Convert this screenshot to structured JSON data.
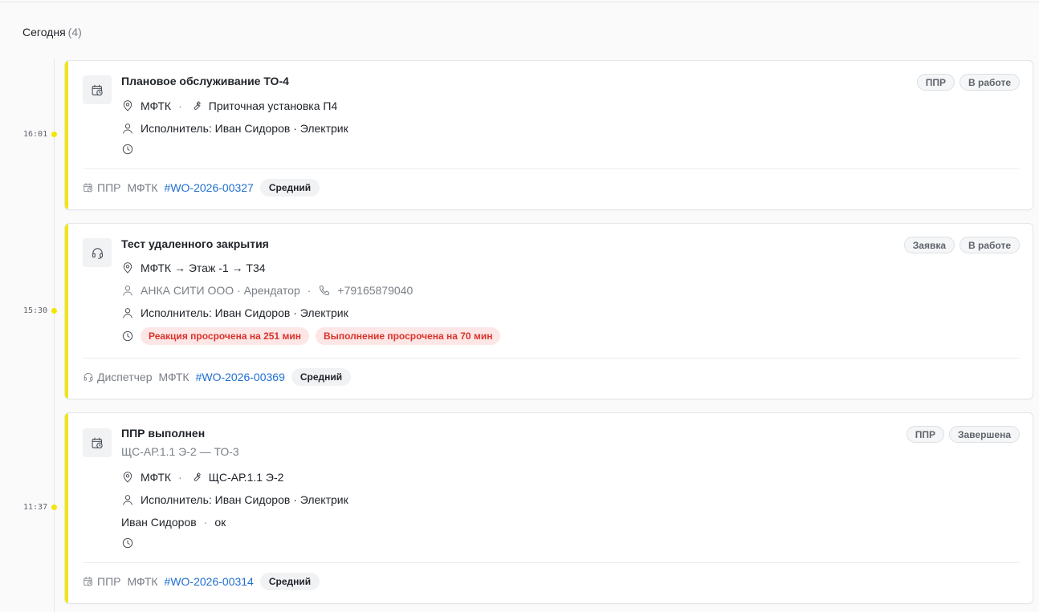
{
  "section": {
    "title": "Сегодня",
    "count": "(4)"
  },
  "accent_color": "#f3e600",
  "link_color": "#1f6fd1",
  "danger_color": "#d9342b",
  "events": [
    {
      "time": "16:01",
      "icon": "calendar-clock-icon",
      "title": "Плановое обслуживание ТО-4",
      "location": "МФТК",
      "equipment": "Приточная установка П4",
      "assignee": "Исполнитель: Иван Сидоров · Электрик",
      "badges": [
        "ППР",
        "В работе"
      ],
      "footer": {
        "type": "ППР",
        "site": "МФТК",
        "number": "#WO-2026-00327",
        "priority": "Средний"
      }
    },
    {
      "time": "15:30",
      "icon": "headset-icon",
      "title": "Тест удаленного закрытия",
      "location": "МФТК → Этаж -1 → Т34",
      "requester": "АНКА СИТИ ООО · Арендатор",
      "phone": "+79165879040",
      "assignee": "Исполнитель: Иван Сидоров · Электрик",
      "sla": [
        "Реакция просрочена на 251 мин",
        "Выполнение просрочена на 70 мин"
      ],
      "badges": [
        "Заявка",
        "В работе"
      ],
      "footer": {
        "type": "Диспетчер",
        "site": "МФТК",
        "number": "#WO-2026-00369",
        "priority": "Средний"
      }
    },
    {
      "time": "11:37",
      "icon": "calendar-clock-icon",
      "title": "ППР выполнен",
      "subtitle": "ЩС-АР.1.1 Э-2 — ТО-3",
      "location": "МФТК",
      "equipment": "ЩС-АР.1.1 Э-2",
      "assignee": "Исполнитель: Иван Сидоров · Электрик",
      "comment_author": "Иван Сидоров",
      "comment_text": "ок",
      "badges": [
        "ППР",
        "Завершена"
      ],
      "footer": {
        "type": "ППР",
        "site": "МФТК",
        "number": "#WO-2026-00314",
        "priority": "Средний"
      }
    }
  ]
}
